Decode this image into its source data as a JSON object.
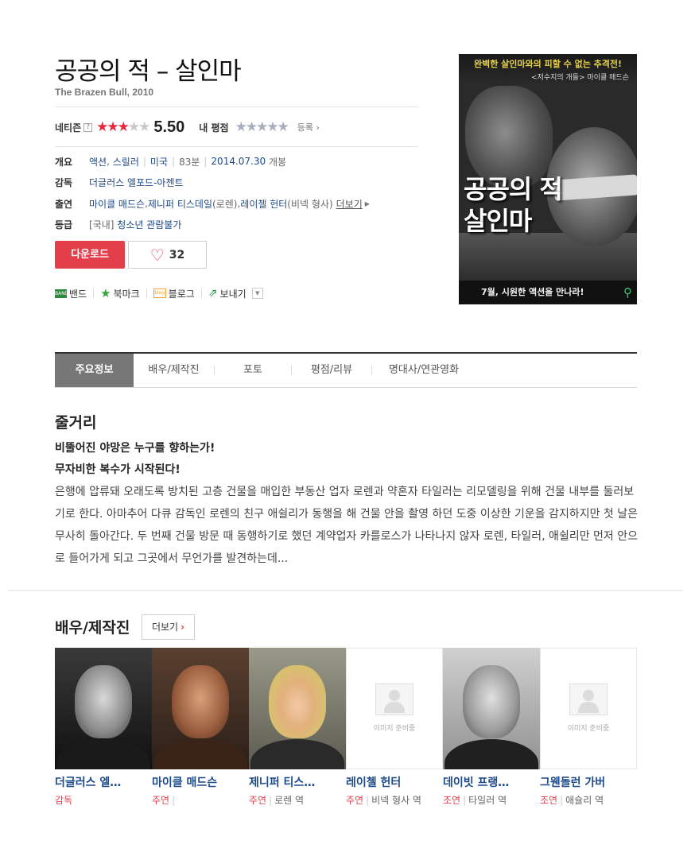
{
  "movie": {
    "title": "공공의 적 – 살인마",
    "original_title": "The Brazen Bull, 2010"
  },
  "rating": {
    "netizen_label": "네티즌",
    "help_glyph": "?",
    "netizen_score": "5.50",
    "netizen_score_value": 5.5,
    "my_label": "내 평점",
    "register_label": "등록",
    "register_glyph": "›"
  },
  "info": {
    "overview_label": "개요",
    "genres": [
      "액션",
      "스릴러"
    ],
    "genre_separator": ",",
    "country": "미국",
    "runtime": "83분",
    "release_date": "2014.07.30",
    "release_suffix": "개봉",
    "director_label": "감독",
    "director": "더글러스 엘포드-아젠트",
    "cast_label": "출연",
    "cast_line": [
      {
        "name": "마이클 매드슨",
        "role": "",
        "sep": ", "
      },
      {
        "name": "제니퍼 티스데일",
        "role": "(로렌)",
        "sep": ", "
      },
      {
        "name": "레이첼 헌터",
        "role": "(비넥 형사)",
        "sep": ""
      }
    ],
    "cast_more": "더보기",
    "grade_label": "등급",
    "grade_prefix": "[국내]",
    "grade": "청소년 관람불가"
  },
  "actions": {
    "download_label": "다운로드",
    "like_count": "32"
  },
  "share": {
    "band": "밴드",
    "bookmark": "북마크",
    "blog": "블로그",
    "send": "보내기",
    "band_icon_text": "BAND",
    "blog_icon_text": "blog"
  },
  "poster": {
    "tagline": "완벽한 살인마와의 피할 수 없는 추격전!",
    "tagline2": "<저수지의 개들> 마이클 매드슨",
    "title_line1": "공공의 적",
    "title_line2": "살인마",
    "bottom_text": "7월, 시원한 액션을 만나라!"
  },
  "tabs": [
    {
      "label": "주요정보",
      "active": true
    },
    {
      "label": "배우/제작진",
      "active": false
    },
    {
      "label": "포토",
      "active": false
    },
    {
      "label": "평점/리뷰",
      "active": false
    },
    {
      "label": "명대사/연관영화",
      "active": false
    }
  ],
  "synopsis": {
    "heading": "줄거리",
    "line1": "비뚤어진 야망은 누구를 향하는가!",
    "line2": "무자비한 복수가 시작된다!",
    "body": "은행에 압류돼 오래도록 방치된 고층 건물을 매입한 부동산 업자 로렌과 약혼자 타일러는 리모델링을 위해 건물 내부를 둘러보기로 한다. 아마추어 다큐 감독인 로렌의 친구 애쉴리가 동행을 해 건물 안을 촬영 하던 도중 이상한 기운을 감지하지만 첫 날은 무사히 돌아간다. 두 번째 건물 방문 때 동행하기로 했던 계약업자 카를로스가 나타나지 않자 로렌, 타일러, 애쉴리만 먼저 안으로 들어가게 되고 그곳에서 무언가를 발견하는데..."
  },
  "cast_section": {
    "heading": "배우/제작진",
    "more_label": "더보기",
    "more_glyph": "›",
    "placeholder_text": "이미지 준비중",
    "people": [
      {
        "name": "더글러스 엘…",
        "role": "감독",
        "character": "",
        "has_photo": true
      },
      {
        "name": "마이클 매드슨",
        "role": "주연",
        "character": "",
        "has_photo": true
      },
      {
        "name": "제니퍼 티스…",
        "role": "주연",
        "character": "로렌 역",
        "has_photo": true
      },
      {
        "name": "레이첼 헌터",
        "role": "주연",
        "character": "비넥 형사 역",
        "has_photo": false
      },
      {
        "name": "데이빗 프랭…",
        "role": "조연",
        "character": "타일러 역",
        "has_photo": true
      },
      {
        "name": "그웬돌런 가버",
        "role": "조연",
        "character": "애슐리 역",
        "has_photo": false
      }
    ]
  },
  "colors": {
    "accent_red": "#e33f4b",
    "link_blue": "#1c4a89",
    "star_red": "#e9263b",
    "tab_active_bg": "#777777"
  }
}
